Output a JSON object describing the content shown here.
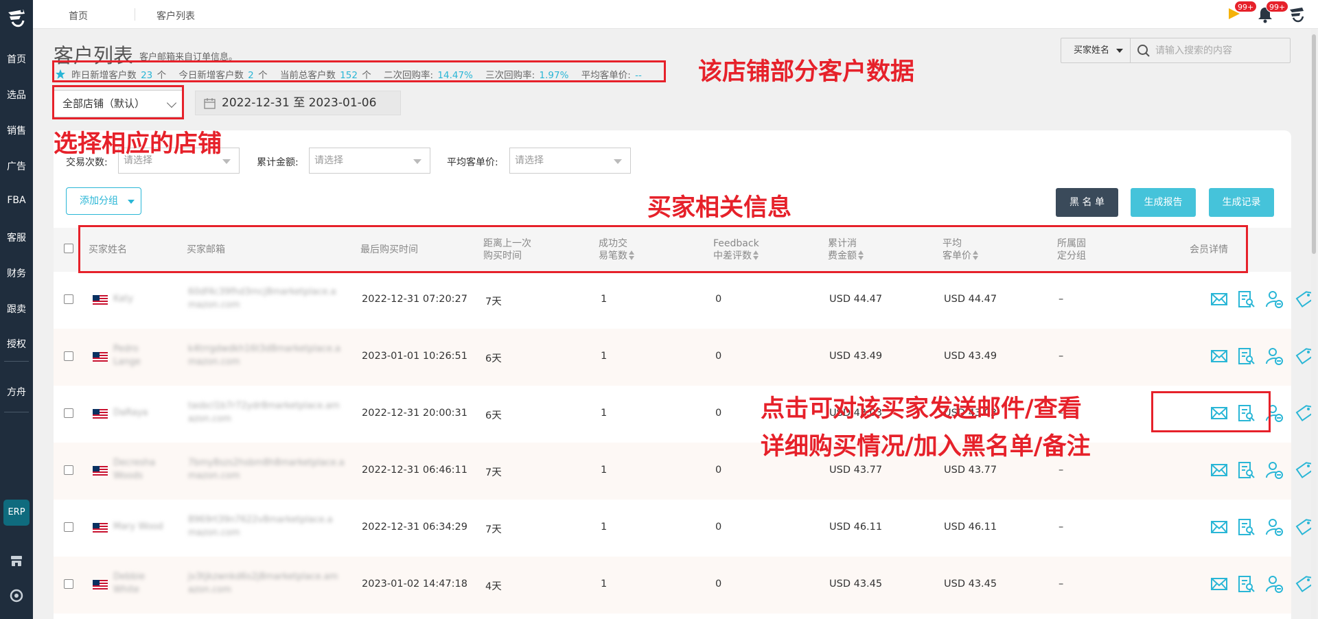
{
  "nav": {
    "home": "首页",
    "selection": "选品",
    "sales": "销售",
    "ads": "广告",
    "fba": "FBA",
    "service": "客服",
    "finance": "财务",
    "follow": "跟卖",
    "auth": "授权",
    "fangzhou": "方舟",
    "erp": "ERP"
  },
  "topbar": {
    "crumb_home": "首页",
    "crumb_current": "客户列表",
    "flag_badge": "99+",
    "bell_badge": "99+"
  },
  "header": {
    "title": "客户列表",
    "subtitle": "客户邮箱来自订单信息。"
  },
  "stats": {
    "yesterday_label": "昨日新增客户数",
    "yesterday_value": "23",
    "yesterday_unit": "个",
    "today_label": "今日新增客户数",
    "today_value": "2",
    "today_unit": "个",
    "total_label": "当前总客户数",
    "total_value": "152",
    "total_unit": "个",
    "repurchase2_label": "二次回购率:",
    "repurchase2_value": "14.47%",
    "repurchase3_label": "三次回购率:",
    "repurchase3_value": "1.97%",
    "avg_label": "平均客单价:",
    "avg_value": "--"
  },
  "search": {
    "field": "买家姓名",
    "placeholder": "请输入搜索的内容"
  },
  "store_select": "全部店铺（默认）",
  "date_range": "2022-12-31 至 2023-01-06",
  "filters": {
    "trade_count_label": "交易次数:",
    "total_amount_label": "累计金额:",
    "avg_price_label": "平均客单价:",
    "placeholder": "请选择"
  },
  "buttons": {
    "add_group": "添加分组",
    "blacklist": "黑 名 单",
    "generate_report": "生成报告",
    "generate_record": "生成记录"
  },
  "columns": {
    "name": "买家姓名",
    "email": "买家邮箱",
    "last_time": "最后购买时间",
    "since_line1": "距离上一次",
    "since_line2": "购买时间",
    "orders_line1": "成功交",
    "orders_line2": "易笔数",
    "feedback_line1": "Feedback",
    "feedback_line2": "中差评数",
    "total_line1": "累计消",
    "total_line2": "费金额",
    "avg_line1": "平均",
    "avg_line2": "客单价",
    "group_line1": "所属固",
    "group_line2": "定分组",
    "member": "会员详情"
  },
  "rows": [
    {
      "name1": "Katy",
      "name2": "",
      "email1": "60df4c39fhd3mcj8marketplace.a",
      "email2": "mazon.com",
      "last_time": "2022-12-31 07:20:27",
      "since": "7天",
      "orders": "1",
      "feedback": "0",
      "total": "USD 44.47",
      "avg": "USD 44.47",
      "group": "–"
    },
    {
      "name1": "Pedro",
      "name2": "Lange",
      "email1": "k4trrgdwdkh16t3d8marketplace.a",
      "email2": "mazon.com",
      "last_time": "2023-01-01 10:26:51",
      "since": "6天",
      "orders": "1",
      "feedback": "0",
      "total": "USD 43.49",
      "avg": "USD 43.49",
      "group": "–"
    },
    {
      "name1": "DaRaya",
      "name2": "",
      "email1": "tasbcl1b7r72ydr8marketplace.am",
      "email2": "azon.com",
      "last_time": "2022-12-31 20:00:31",
      "since": "6天",
      "orders": "1",
      "feedback": "0",
      "total": "USD 43.03",
      "avg": "USD 43.03",
      "group": "–"
    },
    {
      "name1": "Decresha",
      "name2": "Woods",
      "email1": "7bmy8szs2hsbm8h8marketplace.a",
      "email2": "mazon.com",
      "last_time": "2022-12-31 06:46:11",
      "since": "7天",
      "orders": "1",
      "feedback": "0",
      "total": "USD 43.77",
      "avg": "USD 43.77",
      "group": "–"
    },
    {
      "name1": "Mary Wood",
      "name2": "",
      "email1": "8969rt39n7622v8marketplace.a",
      "email2": "mazon.com",
      "last_time": "2022-12-31 06:34:29",
      "since": "7天",
      "orders": "1",
      "feedback": "0",
      "total": "USD 46.11",
      "avg": "USD 46.11",
      "group": "–"
    },
    {
      "name1": "Debbie",
      "name2": "White",
      "email1": "jv3tjkzwnkd6s2j8marketplace.am",
      "email2": "azon.com",
      "last_time": "2023-01-02 14:47:18",
      "since": "4天",
      "orders": "1",
      "feedback": "0",
      "total": "USD 43.45",
      "avg": "USD 43.45",
      "group": "–"
    }
  ],
  "annotations": {
    "store_data": "该店铺部分客户数据",
    "select_store": "选择相应的店铺",
    "buyer_info": "买家相关信息",
    "actions_line1": "点击可对该买家发送邮件/查看",
    "actions_line2": "详细购买情况/加入黑名单/备注"
  },
  "colors": {
    "accent": "#29b6d6",
    "annotation": "#e6212a",
    "sidebar": "#1f2d3d",
    "dark_button": "#3a4a5a",
    "cyan_button": "#45c3da"
  },
  "icons": {
    "row_actions": [
      "mail-icon",
      "report-icon",
      "user-block-icon",
      "tag-icon"
    ]
  }
}
